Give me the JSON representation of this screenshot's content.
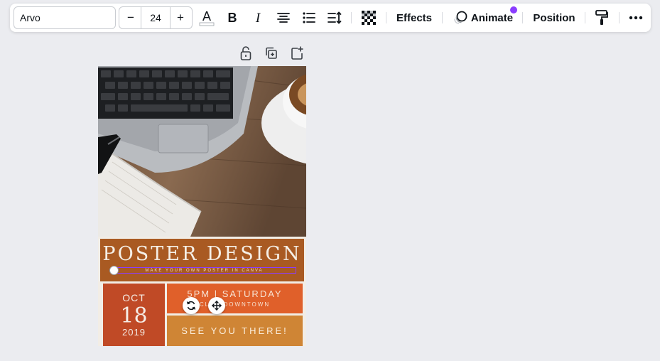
{
  "toolbar": {
    "font_family": "Arvo",
    "font_size": "24",
    "minus_label": "−",
    "plus_label": "+",
    "effects_label": "Effects",
    "animate_label": "Animate",
    "position_label": "Position",
    "icons": [
      "text-color-icon",
      "bold-icon",
      "italic-icon",
      "align-center-icon",
      "list-icon",
      "spacing-icon",
      "transparency-icon",
      "animate-icon",
      "paint-roller-icon",
      "more-icon"
    ],
    "accent_color": "#8b3dff"
  },
  "page_actions": {
    "icons": [
      "lock-icon",
      "duplicate-page-icon",
      "add-page-icon"
    ]
  },
  "poster": {
    "title": "POSTER DESIGN",
    "subtitle": "MAKE YOUR OWN POSTER IN CANVA",
    "date_month": "OCT",
    "date_day": "18",
    "date_year": "2019",
    "time_line1": "5PM | SATURDAY",
    "time_line2": "CLUB DOWNTOWN",
    "tagline": "SEE YOU THERE!",
    "colors": {
      "title_band": "#a95a22",
      "date_box": "#c04a26",
      "time_box": "#e0602a",
      "tagline_box": "#cf8535"
    }
  }
}
